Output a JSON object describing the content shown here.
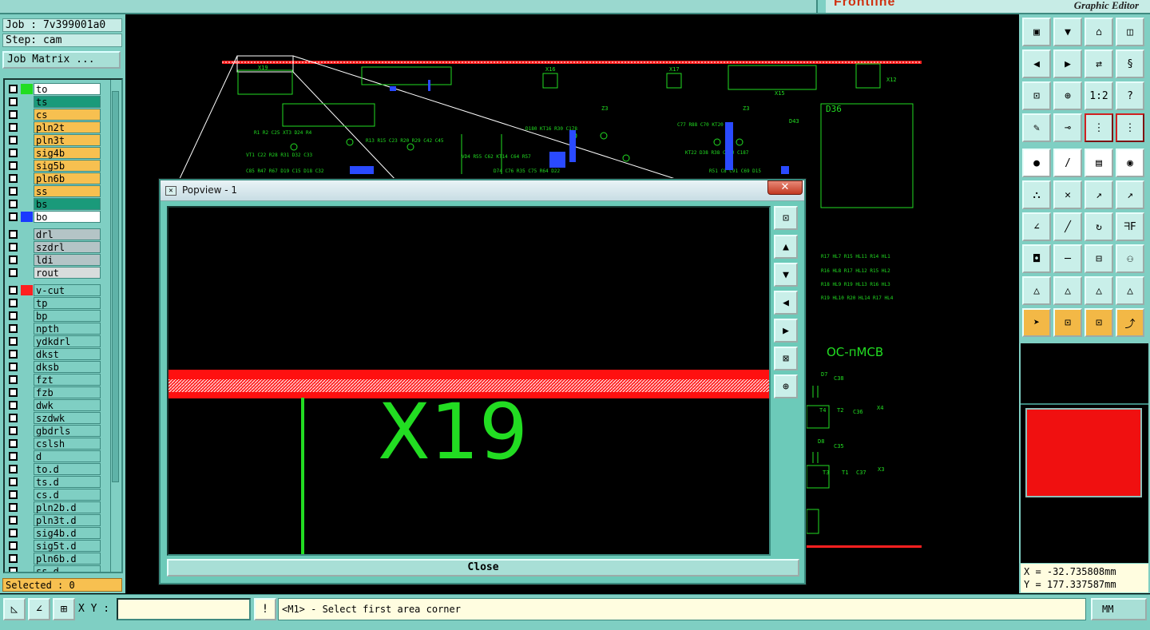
{
  "brand": {
    "logo": "Frontline",
    "subtitle": "Graphic Editor"
  },
  "job": {
    "job_line": "Job : 7v399001a0",
    "step_line": "Step: cam",
    "matrix_button": "Job Matrix ..."
  },
  "layers": [
    {
      "name": "to",
      "color": "#ffffff",
      "swatch": "#22dd22"
    },
    {
      "name": "ts",
      "color": "#1a9a7a",
      "swatch": ""
    },
    {
      "name": "cs",
      "color": "#f7c050",
      "swatch": ""
    },
    {
      "name": "pln2t",
      "color": "#f7c050",
      "swatch": ""
    },
    {
      "name": "pln3t",
      "color": "#f7c050",
      "swatch": ""
    },
    {
      "name": "sig4b",
      "color": "#f7c050",
      "swatch": ""
    },
    {
      "name": "sig5b",
      "color": "#f7c050",
      "swatch": ""
    },
    {
      "name": "pln6b",
      "color": "#f7c050",
      "swatch": ""
    },
    {
      "name": "ss",
      "color": "#f7c050",
      "swatch": ""
    },
    {
      "name": "bs",
      "color": "#1a9a7a",
      "swatch": ""
    },
    {
      "name": "bo",
      "color": "#ffffff",
      "swatch": "#1a3aff"
    },
    {
      "name": "drl",
      "color": "#b4c4c6",
      "swatch": ""
    },
    {
      "name": "szdrl",
      "color": "#b4c4c6",
      "swatch": ""
    },
    {
      "name": "ldi",
      "color": "#b4c4c6",
      "swatch": ""
    },
    {
      "name": "rout",
      "color": "#d8dcdc",
      "swatch": ""
    },
    {
      "name": "v-cut",
      "color": "#7fcfc3",
      "swatch": "#ff2020"
    },
    {
      "name": "tp",
      "color": "#7fcfc3",
      "swatch": ""
    },
    {
      "name": "bp",
      "color": "#7fcfc3",
      "swatch": ""
    },
    {
      "name": "npth",
      "color": "#7fcfc3",
      "swatch": ""
    },
    {
      "name": "ydkdrl",
      "color": "#7fcfc3",
      "swatch": ""
    },
    {
      "name": "dkst",
      "color": "#7fcfc3",
      "swatch": ""
    },
    {
      "name": "dksb",
      "color": "#7fcfc3",
      "swatch": ""
    },
    {
      "name": "fzt",
      "color": "#7fcfc3",
      "swatch": ""
    },
    {
      "name": "fzb",
      "color": "#7fcfc3",
      "swatch": ""
    },
    {
      "name": "dwk",
      "color": "#7fcfc3",
      "swatch": ""
    },
    {
      "name": "szdwk",
      "color": "#7fcfc3",
      "swatch": ""
    },
    {
      "name": "gbdrls",
      "color": "#7fcfc3",
      "swatch": ""
    },
    {
      "name": "cslsh",
      "color": "#7fcfc3",
      "swatch": ""
    },
    {
      "name": "d",
      "color": "#7fcfc3",
      "swatch": ""
    },
    {
      "name": "to.d",
      "color": "#7fcfc3",
      "swatch": ""
    },
    {
      "name": "ts.d",
      "color": "#7fcfc3",
      "swatch": ""
    },
    {
      "name": "cs.d",
      "color": "#7fcfc3",
      "swatch": ""
    },
    {
      "name": "pln2b.d",
      "color": "#7fcfc3",
      "swatch": ""
    },
    {
      "name": "pln3t.d",
      "color": "#7fcfc3",
      "swatch": ""
    },
    {
      "name": "sig4b.d",
      "color": "#7fcfc3",
      "swatch": ""
    },
    {
      "name": "sig5t.d",
      "color": "#7fcfc3",
      "swatch": ""
    },
    {
      "name": "pln6b.d",
      "color": "#7fcfc3",
      "swatch": ""
    },
    {
      "name": "ss.d",
      "color": "#7fcfc3",
      "swatch": ""
    }
  ],
  "selected": "Selected : 0",
  "canvas_labels": {
    "x19": "X19",
    "x16": "X16",
    "x17": "X17",
    "x15": "X15",
    "x12": "X12",
    "d36": "D36",
    "z3a": "Z3",
    "z3b": "Z3",
    "d43": "D43",
    "brand_text": "OC-пMCB",
    "d7": "D7",
    "c38": "C38",
    "t4": "T4",
    "t2": "T2",
    "c36": "C36",
    "x4": "X4",
    "d8": "D8",
    "c35": "C35",
    "t3": "T3",
    "t1": "T1",
    "c37": "C37",
    "x3": "X3"
  },
  "popview": {
    "title": "Popview - 1",
    "close_x": "✕",
    "label": "X19",
    "close_button": "Close"
  },
  "coords": {
    "x": "X = -32.735808mm",
    "y": "Y = 177.337587mm"
  },
  "status": {
    "xy_label": "X Y :",
    "xy_value": "",
    "message": "<M1> - Select first area corner",
    "unit": "MM",
    "alert": "!"
  },
  "colors": {
    "panel": "#7fcfc3",
    "copper": "#22dd22",
    "red": "#f01010",
    "yellow": "#f0f020",
    "blue": "#2a4aff"
  }
}
